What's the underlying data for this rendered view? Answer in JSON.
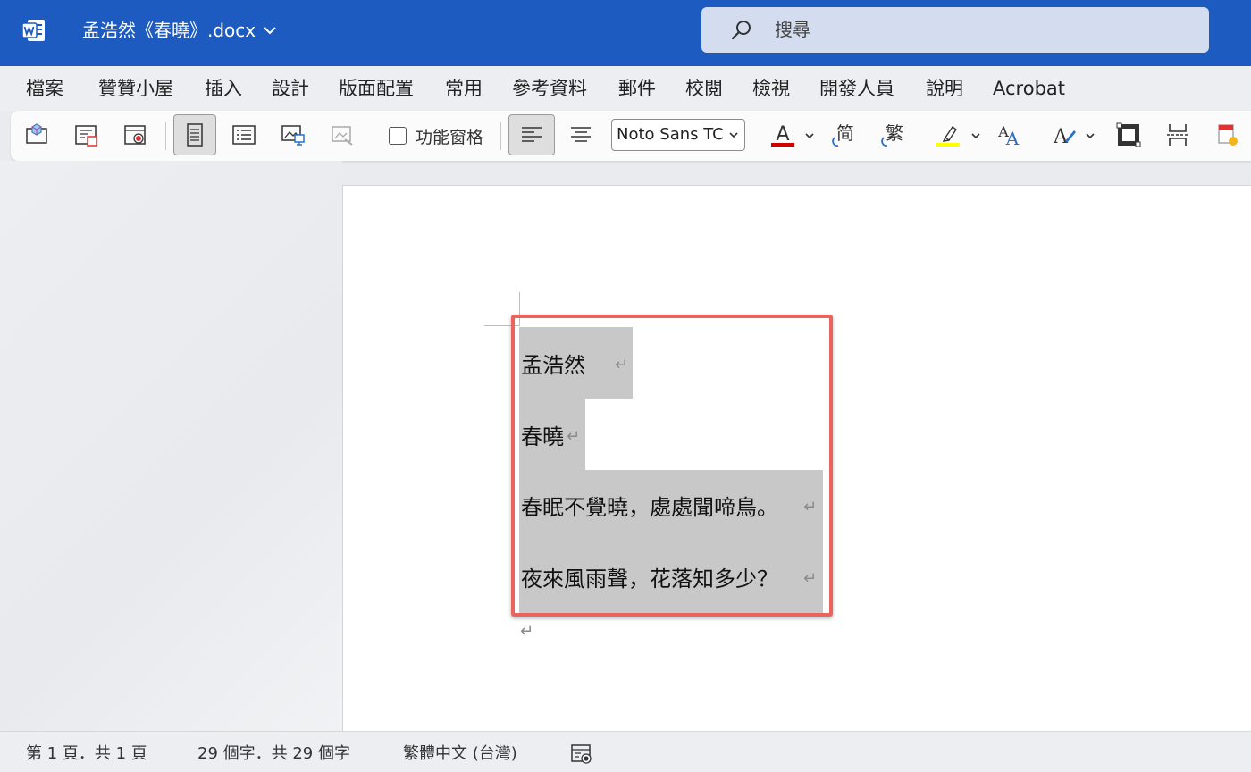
{
  "titlebar": {
    "doc_title": "孟浩然《春曉》.docx",
    "search_placeholder": "搜尋",
    "app_icon": "word-icon"
  },
  "menu": {
    "items": [
      "檔案",
      "贊贊小屋",
      "插入",
      "設計",
      "版面配置",
      "常用",
      "參考資料",
      "郵件",
      "校閱",
      "檢視",
      "開發人員",
      "說明",
      "Acrobat"
    ]
  },
  "ribbon": {
    "nav_pane_label": "功能窗格",
    "font_name": "Noto Sans TC",
    "simplified_glyph": "简",
    "traditional_glyph": "繁",
    "font_color_glyph": "A",
    "font_color": "#d40000",
    "highlight_color": "#ffff00"
  },
  "document": {
    "lines": [
      "孟浩然",
      "春曉",
      "春眠不覺曉，處處聞啼鳥。",
      "夜來風雨聲，花落知多少？"
    ],
    "paragraph_mark": "↵",
    "selection_color": "#c8c8c8",
    "annotation_color": "#e8645c"
  },
  "statusbar": {
    "page_info": "第 1 頁．共 1 頁",
    "word_count": "29 個字．共 29 個字",
    "language": "繁體中文 (台灣)"
  }
}
